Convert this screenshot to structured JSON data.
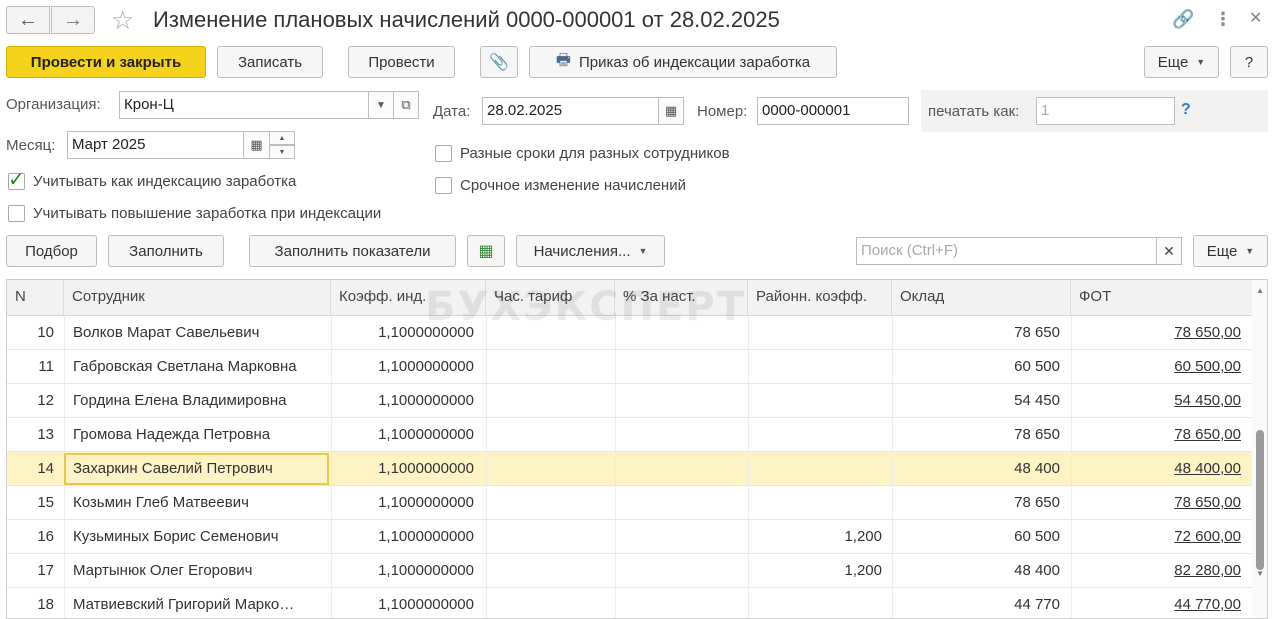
{
  "header": {
    "title": "Изменение плановых начислений 0000-000001 от 28.02.2025"
  },
  "toolbar": {
    "post_close": "Провести и закрыть",
    "save": "Записать",
    "post": "Провести",
    "print_order": "Приказ об индексации заработка",
    "more": "Еще",
    "help": "?"
  },
  "form": {
    "org_label": "Организация:",
    "org_value": "Крон-Ц",
    "month_label": "Месяц:",
    "month_value": "Март 2025",
    "indexation_cb": "Учитывать как индексацию заработка",
    "indexation_checked": true,
    "raise_cb": "Учитывать повышение заработка при индексации",
    "raise_checked": false,
    "date_label": "Дата:",
    "date_value": "28.02.2025",
    "number_label": "Номер:",
    "number_value": "0000-000001",
    "print_as_label": "печатать как:",
    "print_as_value": "1",
    "print_as_help": "?",
    "diff_terms_cb": "Разные сроки для разных сотрудников",
    "urgent_cb": "Срочное изменение начислений"
  },
  "table_toolbar": {
    "pick": "Подбор",
    "fill": "Заполнить",
    "fill_indicators": "Заполнить показатели",
    "accruals": "Начисления...",
    "search_placeholder": "Поиск (Ctrl+F)",
    "more": "Еще"
  },
  "table": {
    "columns": {
      "n": "N",
      "employee": "Сотрудник",
      "coef": "Коэфф. инд.",
      "hourly": "Час. тариф",
      "pct": "%  За наст.",
      "regional": "Районн. коэфф.",
      "salary": "Оклад",
      "fot": "ФОТ"
    },
    "rows": [
      {
        "n": "10",
        "employee": "Волков Марат Савельевич",
        "coef": "1,1000000000",
        "regional": "",
        "salary": "78 650",
        "fot": "78 650,00"
      },
      {
        "n": "11",
        "employee": "Габровская Светлана Марковна",
        "coef": "1,1000000000",
        "regional": "",
        "salary": "60 500",
        "fot": "60 500,00"
      },
      {
        "n": "12",
        "employee": "Гордина Елена Владимировна",
        "coef": "1,1000000000",
        "regional": "",
        "salary": "54 450",
        "fot": "54 450,00"
      },
      {
        "n": "13",
        "employee": "Громова Надежда Петровна",
        "coef": "1,1000000000",
        "regional": "",
        "salary": "78 650",
        "fot": "78 650,00"
      },
      {
        "n": "14",
        "employee": "Захаркин Савелий Петрович",
        "coef": "1,1000000000",
        "regional": "",
        "salary": "48 400",
        "fot": "48 400,00"
      },
      {
        "n": "15",
        "employee": "Козьмин Глеб Матвеевич",
        "coef": "1,1000000000",
        "regional": "",
        "salary": "78 650",
        "fot": "78 650,00"
      },
      {
        "n": "16",
        "employee": "Кузьминых Борис Семенович",
        "coef": "1,1000000000",
        "regional": "1,200",
        "salary": "60 500",
        "fot": "72 600,00"
      },
      {
        "n": "17",
        "employee": "Мартынюк Олег Егорович",
        "coef": "1,1000000000",
        "regional": "1,200",
        "salary": "48 400",
        "fot": "82 280,00"
      },
      {
        "n": "18",
        "employee": "Матвиевский Григорий Марко…",
        "coef": "1,1000000000",
        "regional": "",
        "salary": "44 770",
        "fot": "44 770,00"
      }
    ]
  },
  "watermark": "БУХЭКСПЕРТ"
}
